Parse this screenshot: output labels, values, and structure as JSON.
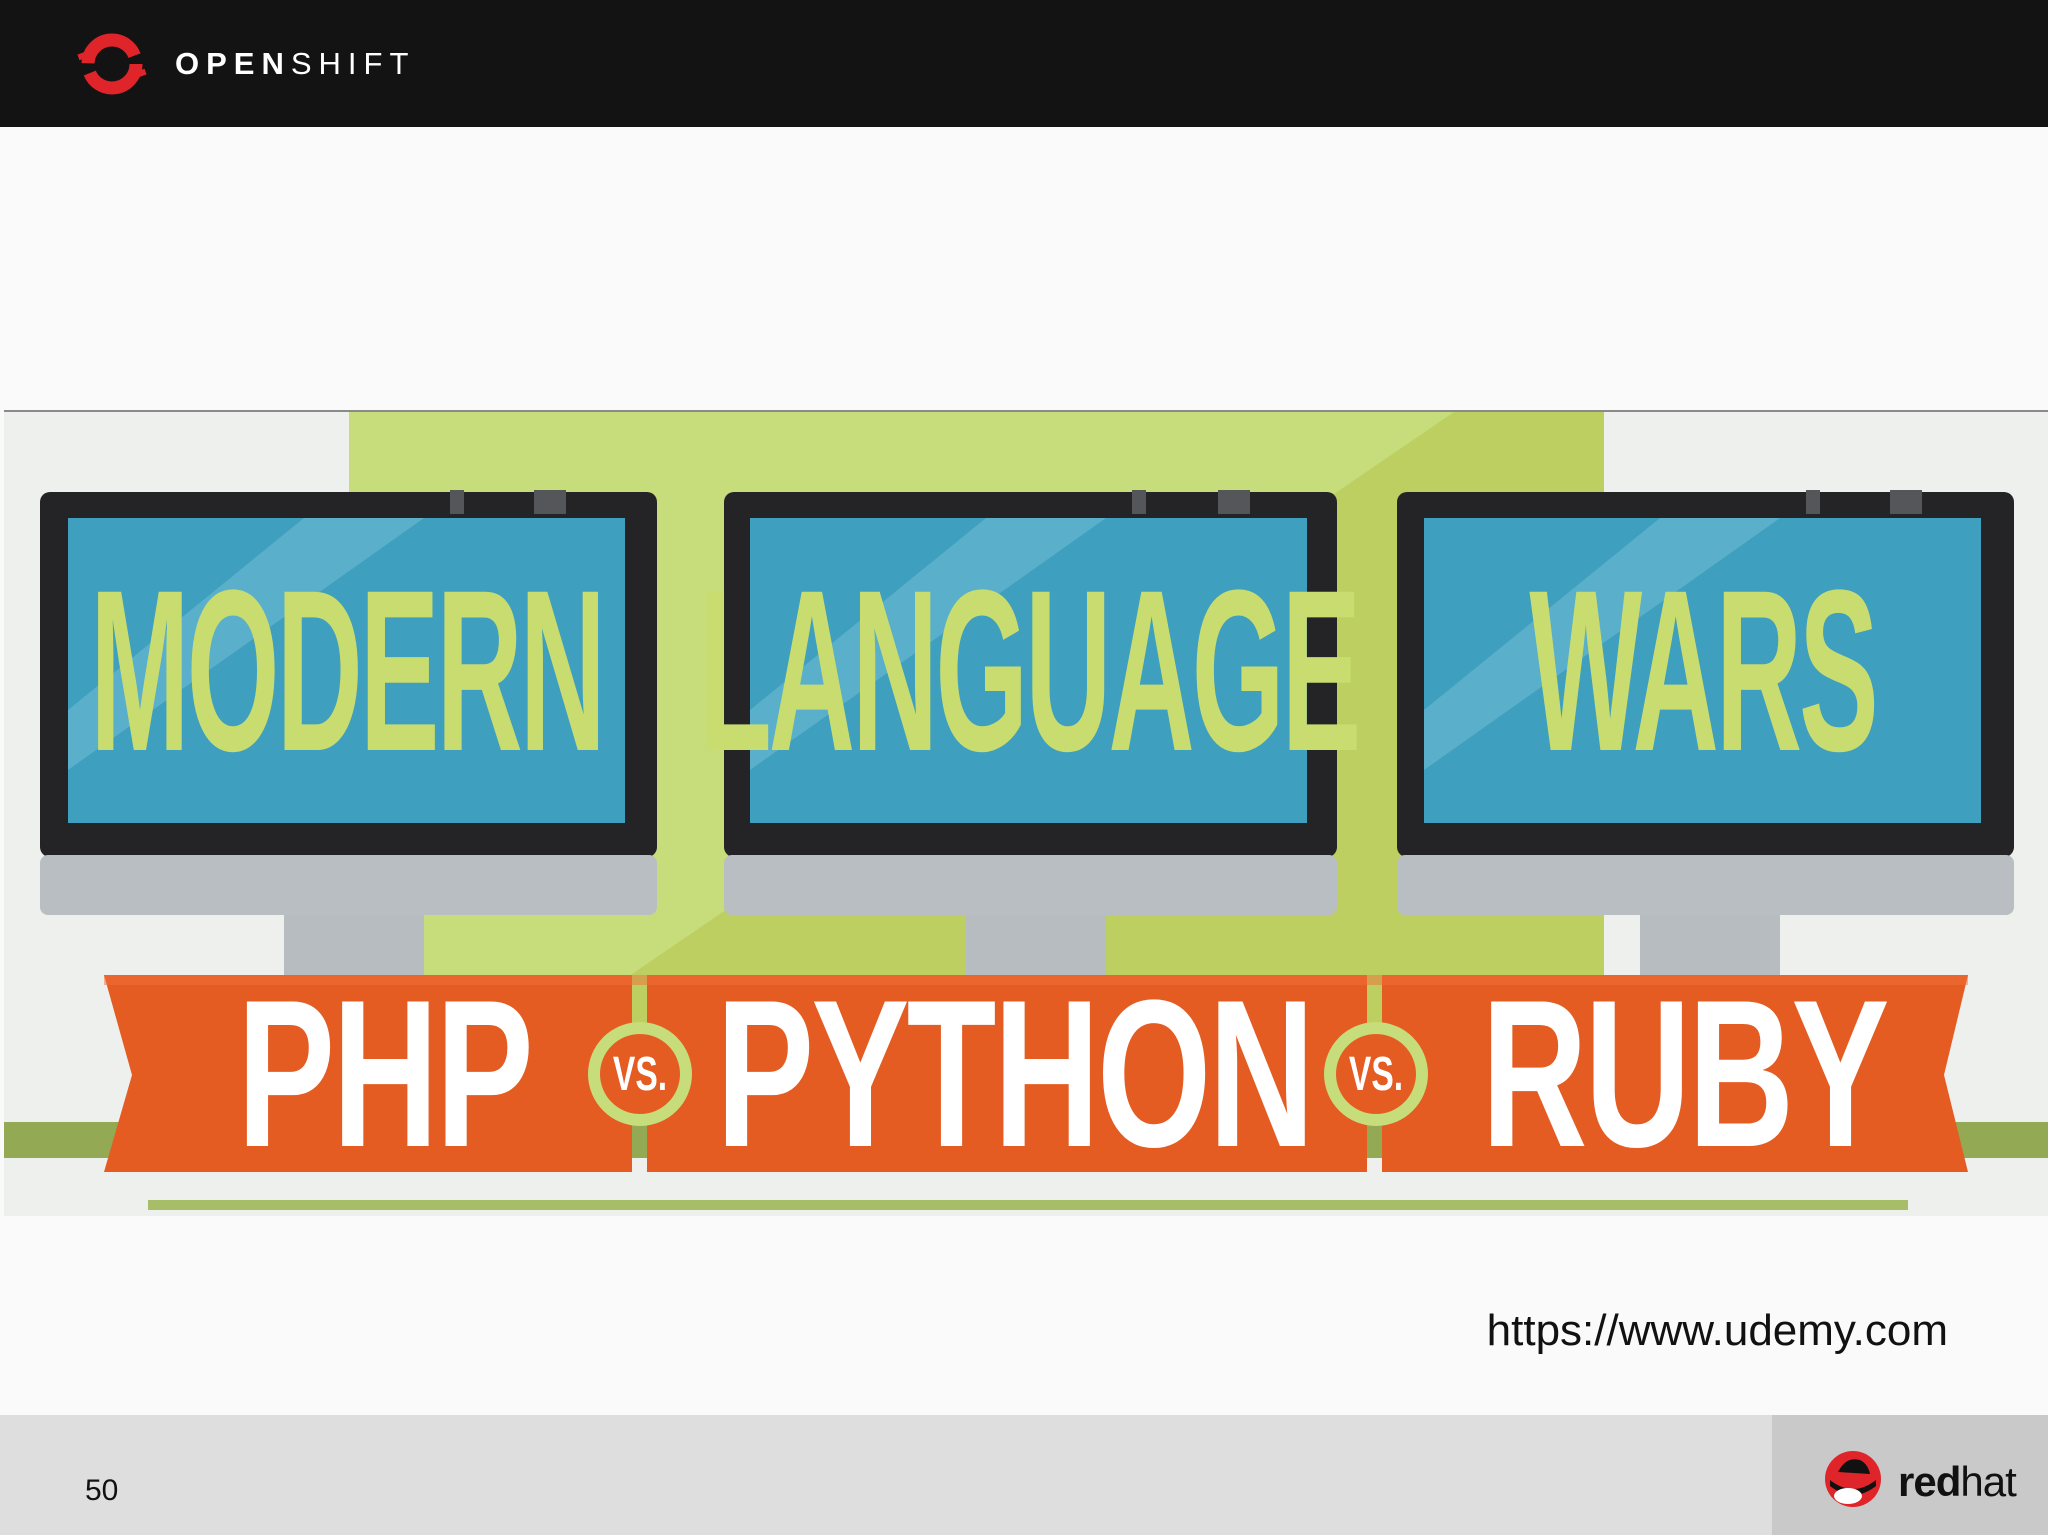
{
  "header": {
    "brand_bold": "OPEN",
    "brand_light": "SHIFT"
  },
  "banner": {
    "screens": [
      "MODERN",
      "LANGUAGE",
      "WARS"
    ],
    "languages": [
      "PHP",
      "PYTHON",
      "RUBY"
    ],
    "versus": [
      "VS.",
      "VS."
    ]
  },
  "source": {
    "url": "https://www.udemy.com"
  },
  "footer": {
    "page_number": "50",
    "brand_bold": "red",
    "brand_light": "hat"
  },
  "colors": {
    "header_bg": "#141314",
    "screen_blue": "#3f9fbe",
    "screen_text_green": "#c8dc6f",
    "banner_orange": "#e45c22",
    "background_green": "#c7dc7a",
    "brand_red": "#e0252a"
  }
}
